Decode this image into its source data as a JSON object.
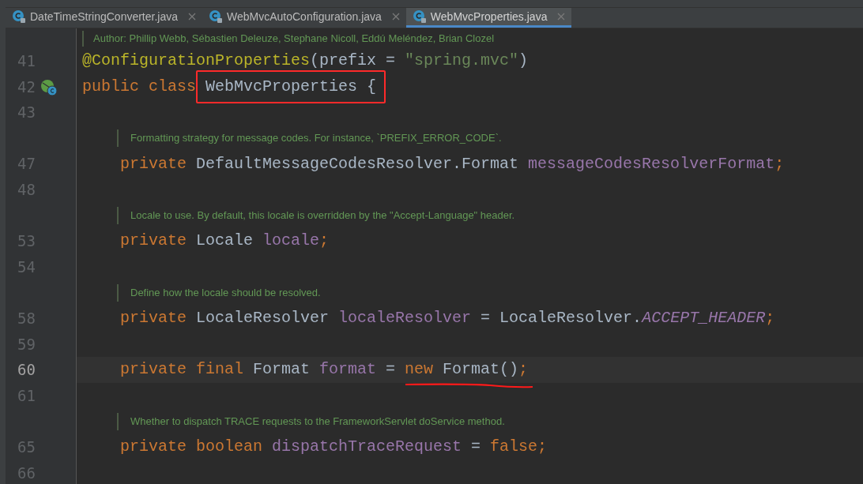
{
  "tabs": [
    {
      "label": "DateTimeStringConverter.java",
      "selected": false
    },
    {
      "label": "WebMvcAutoConfiguration.java",
      "selected": false
    },
    {
      "label": "WebMvcProperties.java",
      "selected": true
    }
  ],
  "author_doc": "Author: Phillip Webb, Sébastien Deleuze, Stephane Nicoll, Eddú Meléndez, Brian Clozel",
  "rows": [
    {
      "kind": "code",
      "line": "41",
      "in_class": false,
      "current": false,
      "tokens": [
        {
          "text": "@ConfigurationProperties",
          "kind": "annotation"
        },
        {
          "text": "(prefix = ",
          "kind": "plain"
        },
        {
          "text": "\"spring.mvc\"",
          "kind": "string"
        },
        {
          "text": ")",
          "kind": "plain"
        }
      ]
    },
    {
      "kind": "code",
      "line": "42",
      "in_class": false,
      "current": false,
      "gutter_icon": true,
      "tokens": [
        {
          "text": "public class ",
          "kind": "keyword"
        },
        {
          "text": "WebMvcProperties {",
          "kind": "plain",
          "boxed": true
        }
      ]
    },
    {
      "kind": "code",
      "line": "43",
      "current": false,
      "tokens": []
    },
    {
      "kind": "doc",
      "text": "Formatting strategy for message codes. For instance, `PREFIX_ERROR_CODE`."
    },
    {
      "kind": "code",
      "line": "47",
      "in_class": true,
      "current": false,
      "tokens": [
        {
          "text": "private ",
          "kind": "keyword"
        },
        {
          "text": "DefaultMessageCodesResolver.Format ",
          "kind": "plain"
        },
        {
          "text": "messageCodesResolverFormat",
          "kind": "field"
        },
        {
          "text": ";",
          "kind": "keyword"
        }
      ]
    },
    {
      "kind": "code",
      "line": "48",
      "current": false,
      "tokens": []
    },
    {
      "kind": "doc",
      "text": "Locale to use. By default, this locale is overridden by the \"Accept-Language\" header."
    },
    {
      "kind": "code",
      "line": "53",
      "in_class": true,
      "current": false,
      "tokens": [
        {
          "text": "private ",
          "kind": "keyword"
        },
        {
          "text": "Locale ",
          "kind": "plain"
        },
        {
          "text": "locale",
          "kind": "field"
        },
        {
          "text": ";",
          "kind": "keyword"
        }
      ]
    },
    {
      "kind": "code",
      "line": "54",
      "current": false,
      "tokens": []
    },
    {
      "kind": "doc",
      "text": "Define how the locale should be resolved."
    },
    {
      "kind": "code",
      "line": "58",
      "in_class": true,
      "current": false,
      "tokens": [
        {
          "text": "private ",
          "kind": "keyword"
        },
        {
          "text": "LocaleResolver ",
          "kind": "plain"
        },
        {
          "text": "localeResolver",
          "kind": "field"
        },
        {
          "text": " = LocaleResolver.",
          "kind": "plain"
        },
        {
          "text": "ACCEPT_HEADER",
          "kind": "constant"
        },
        {
          "text": ";",
          "kind": "keyword"
        }
      ]
    },
    {
      "kind": "code",
      "line": "59",
      "current": false,
      "tokens": []
    },
    {
      "kind": "code",
      "line": "60",
      "in_class": true,
      "current": true,
      "tokens": [
        {
          "text": "private final ",
          "kind": "keyword"
        },
        {
          "text": "Format ",
          "kind": "plain"
        },
        {
          "text": "format",
          "kind": "field"
        },
        {
          "text": " = ",
          "kind": "plain"
        },
        {
          "text": "new ",
          "kind": "keyword",
          "underlined": true
        },
        {
          "text": "Format()",
          "kind": "plain",
          "underlined": true
        },
        {
          "text": ";",
          "kind": "keyword",
          "underlined": true
        }
      ]
    },
    {
      "kind": "code",
      "line": "61",
      "current": false,
      "tokens": []
    },
    {
      "kind": "doc",
      "text": "Whether to dispatch TRACE requests to the FrameworkServlet doService method."
    },
    {
      "kind": "code",
      "line": "65",
      "in_class": true,
      "current": false,
      "tokens": [
        {
          "text": "private ",
          "kind": "keyword"
        },
        {
          "text": "boolean ",
          "kind": "keyword"
        },
        {
          "text": "dispatchTraceRequest",
          "kind": "field"
        },
        {
          "text": " = ",
          "kind": "plain"
        },
        {
          "text": "false",
          "kind": "keyword"
        },
        {
          "text": ";",
          "kind": "keyword"
        }
      ]
    },
    {
      "kind": "code",
      "line": "66",
      "current": false,
      "tokens": []
    }
  ]
}
